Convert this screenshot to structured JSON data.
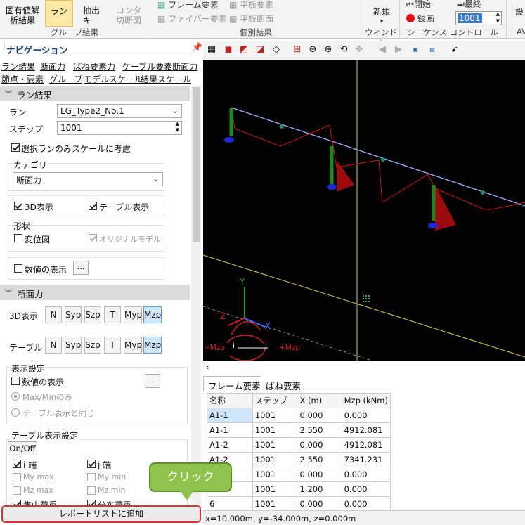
{
  "ribbon": {
    "btn_solid_line1": "固有値解",
    "btn_solid_line2": "析結果",
    "btn_run": "ラン",
    "btn_extract_line1": "抽出",
    "btn_extract_line2": "キー",
    "btn_contour_line1": "コンタ",
    "btn_contour_line2": "切断図",
    "group1": "グループ結果",
    "frame_element": "フレーム要素",
    "fiber_element": "ファイバー要素",
    "plate_element": "平板要素",
    "plate_section": "平板断面",
    "group2": "個別結果",
    "btn_new": "新規",
    "group3": "ウィンドウ",
    "start": "開始",
    "end": "最終",
    "record": "録画",
    "frame_value": "1001",
    "group4": "シーケンス コントロール",
    "group5": "AV",
    "settings": "設"
  },
  "nav": {
    "title": "ナビゲーション",
    "pin": "ꟸ",
    "links_row1": [
      "ラン結果",
      "断面力",
      "ばね要素力",
      "ケーブル要素断面力"
    ],
    "links_row2": [
      "節点・要素",
      "グループ",
      "モデルスケール",
      "結果スケール"
    ],
    "run_section": "ラン結果",
    "run_label": "ラン",
    "run_value": "LG_Type2_No.1",
    "step_label": "ステップ",
    "step_value": "1001",
    "scale_selected_only": "選択ランのみスケールに考慮",
    "category_label": "カテゴリ",
    "category_value": "断面力",
    "show_3d": "3D表示",
    "show_table": "テーブル表示",
    "shape_label": "形状",
    "deformed": "変位図",
    "original_model": "オリジナルモデル",
    "show_values": "数値の表示",
    "ellipsis": "...",
    "force_section": "断面力",
    "display_3d": "3D表示",
    "display_table": "テーブル",
    "force_buttons": [
      "N",
      "Syp",
      "Szp",
      "T",
      "Myp",
      "Mzp"
    ],
    "display_settings": "表示設定",
    "show_numbers": "数値の表示",
    "max_min_only": "Max/Minのみ",
    "same_as_table": "テーブル表示と同じ",
    "table_settings": "テーブル表示設定",
    "onoff": "On/Off",
    "i_end": "i 端",
    "j_end": "j 端",
    "my_max": "My max",
    "my_min": "My min",
    "mz_max": "Mz max",
    "mz_min": "Mz min",
    "concentrated_load": "集中荷重",
    "distributed_load": "分布荷重",
    "add_report": "レポートリストに追加"
  },
  "viewer": {
    "axis_y": "Y",
    "axis_z": "Z",
    "axis_x": "X",
    "moment_left": "+Mzp",
    "moment_right": "+Mzp",
    "moment_i": "i",
    "moment_j": "j"
  },
  "table": {
    "tabs": [
      "フレーム要素",
      "ばね要素"
    ],
    "headers": [
      "名称",
      "ステップ",
      "X (m)",
      "Mzp (kNm)"
    ],
    "rows": [
      [
        "A1-1",
        "1001",
        "0.000",
        "0.000"
      ],
      [
        "A1-1",
        "1001",
        "2.550",
        "4912.081"
      ],
      [
        "A1-2",
        "1001",
        "0.000",
        "4912.081"
      ],
      [
        "A1-2",
        "1001",
        "2.550",
        "7341.231"
      ],
      [
        "",
        "1001",
        "0.000",
        "0.000"
      ],
      [
        "",
        "1001",
        "1.200",
        "0.000"
      ],
      [
        "6",
        "1001",
        "0.000",
        "0.000"
      ]
    ]
  },
  "status": {
    "coords": "x=10.000m, y=-34.000m, z=0.000m"
  },
  "callout": {
    "text": "クリック"
  }
}
